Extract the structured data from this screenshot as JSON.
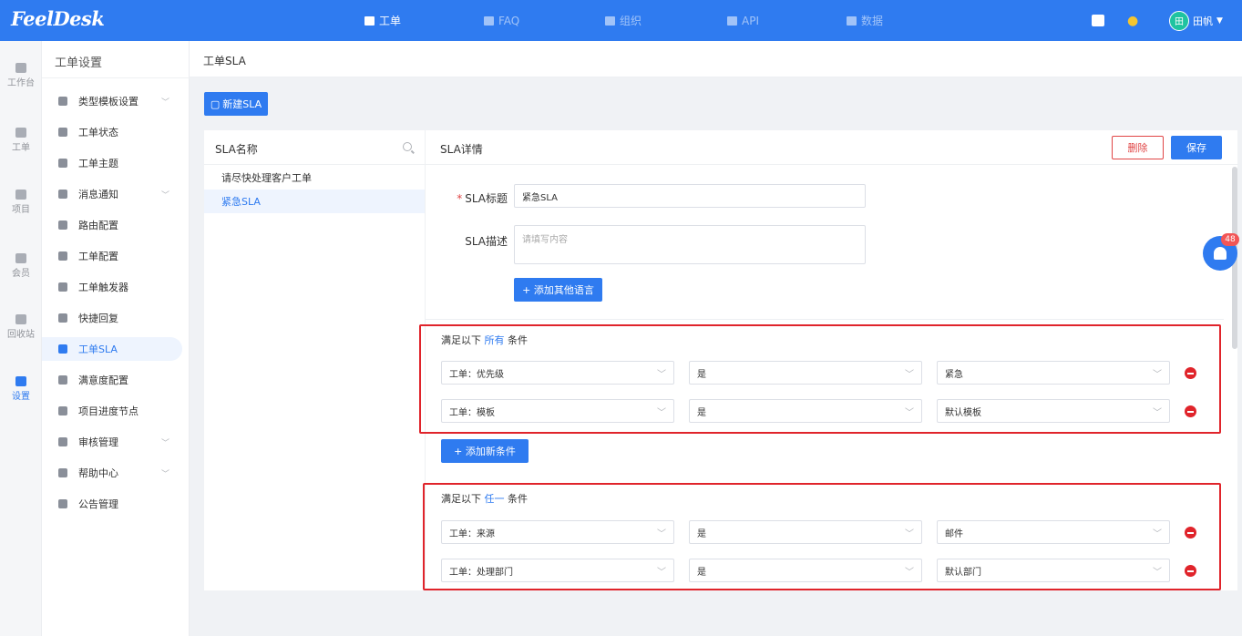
{
  "app": {
    "logo": "FeelDesk"
  },
  "topnav": [
    {
      "label": "工单",
      "icon": "ticket-icon",
      "active": true
    },
    {
      "label": "FAQ",
      "icon": "faq-icon",
      "active": false
    },
    {
      "label": "组织",
      "icon": "org-icon",
      "active": false
    },
    {
      "label": "API",
      "icon": "api-icon",
      "active": false
    },
    {
      "label": "数据",
      "icon": "chart-icon",
      "active": false
    }
  ],
  "user": {
    "avatar_text": "田",
    "name": "田帆"
  },
  "rail": [
    {
      "label": "工作台",
      "icon": "dashboard-icon"
    },
    {
      "label": "工单",
      "icon": "ticket-icon"
    },
    {
      "label": "项目",
      "icon": "folder-icon"
    },
    {
      "label": "会员",
      "icon": "member-icon"
    },
    {
      "label": "回收站",
      "icon": "trash-icon"
    },
    {
      "label": "设置",
      "icon": "wrench-icon"
    }
  ],
  "menu": {
    "title": "工单设置",
    "items": [
      {
        "label": "类型模板设置",
        "icon": "template-icon",
        "expandable": true
      },
      {
        "label": "工单状态",
        "icon": "hourglass-icon",
        "expandable": false
      },
      {
        "label": "工单主题",
        "icon": "palette-icon",
        "expandable": false
      },
      {
        "label": "消息通知",
        "icon": "bell-icon",
        "expandable": true
      },
      {
        "label": "路由配置",
        "icon": "router-icon",
        "expandable": false
      },
      {
        "label": "工单配置",
        "icon": "config-icon",
        "expandable": false
      },
      {
        "label": "工单触发器",
        "icon": "trigger-icon",
        "expandable": false
      },
      {
        "label": "快捷回复",
        "icon": "reply-icon",
        "expandable": false
      },
      {
        "label": "工单SLA",
        "icon": "sla-icon",
        "expandable": false
      },
      {
        "label": "满意度配置",
        "icon": "star-icon",
        "expandable": false
      },
      {
        "label": "项目进度节点",
        "icon": "progress-icon",
        "expandable": false
      },
      {
        "label": "审核管理",
        "icon": "audit-icon",
        "expandable": true
      },
      {
        "label": "帮助中心",
        "icon": "book-icon",
        "expandable": true
      },
      {
        "label": "公告管理",
        "icon": "megaphone-icon",
        "expandable": false
      }
    ]
  },
  "breadcrumb": "工单SLA",
  "new_sla_label": "新建SLA",
  "sla_list": {
    "header": "SLA名称",
    "items": [
      "请尽快处理客户工单",
      "紧急SLA"
    ]
  },
  "detail": {
    "header": "SLA详情",
    "delete_label": "删除",
    "save_label": "保存",
    "title_label": "SLA标题",
    "title_value": "紧急SLA",
    "desc_label": "SLA描述",
    "desc_placeholder": "请填写内容",
    "add_lang_label": "+ 添加其他语言",
    "add_cond_label": "+ 添加新条件",
    "group_all": {
      "prefix": "满足以下",
      "keyword": "所有",
      "suffix": "条件",
      "rows": [
        {
          "field": "工单：优先级",
          "op": "是",
          "value": "紧急"
        },
        {
          "field": "工单：模板",
          "op": "是",
          "value": "默认模板"
        }
      ]
    },
    "group_any": {
      "prefix": "满足以下",
      "keyword": "任一",
      "suffix": "条件",
      "rows": [
        {
          "field": "工单：来源",
          "op": "是",
          "value": "邮件"
        },
        {
          "field": "工单：处理部门",
          "op": "是",
          "value": "默认部门"
        }
      ]
    }
  },
  "notification_badge": "48",
  "colors": {
    "primary": "#2f7bf0",
    "danger": "#e0242b",
    "highlight_box": "#e0242b"
  }
}
